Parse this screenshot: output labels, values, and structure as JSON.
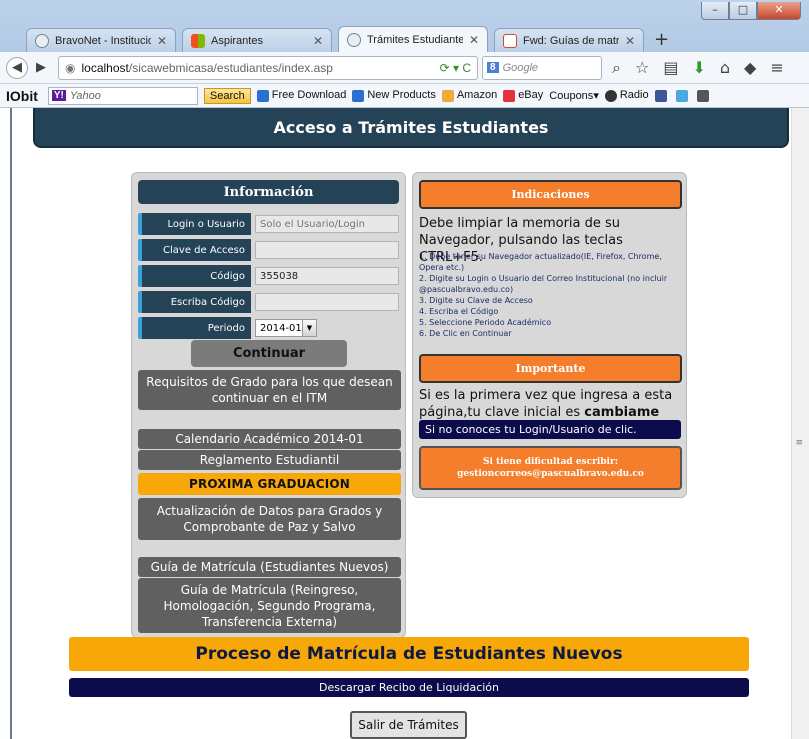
{
  "browser": {
    "tabs": [
      {
        "label": "BravoNet - Institucio...",
        "icon": "globe-icon",
        "color": "#8aa0b8"
      },
      {
        "label": "Aspirantes",
        "icon": "windows-icon",
        "color": "#e8a23c"
      },
      {
        "label": "Trámites Estudiantes...",
        "icon": "globe-icon",
        "color": "#8aa0b8"
      },
      {
        "label": "Fwd: Guías de matrí...",
        "icon": "gmail-icon",
        "color": "#d44638"
      }
    ],
    "url_host": "localhost",
    "url_path": "/sicawebmicasa/estudiantes/index.asp",
    "search_placeholder": "Google",
    "toolbar": {
      "brand": "IObit",
      "yahoo_placeholder": "Yahoo",
      "search_button": "Search",
      "items": [
        "Free Download",
        "New Products",
        "Amazon",
        "eBay",
        "Coupons",
        "Radio"
      ]
    }
  },
  "header": {
    "title": "Acceso a Trámites Estudiantes"
  },
  "info_panel": {
    "title": "Información",
    "fields": [
      {
        "label": "Login o Usuario",
        "placeholder": "Solo el Usuario/Login",
        "value": ""
      },
      {
        "label": "Clave de Acceso",
        "placeholder": "",
        "value": ""
      },
      {
        "label": "Código",
        "placeholder": "",
        "value": "355038"
      },
      {
        "label": "Escriba Código",
        "placeholder": "",
        "value": ""
      }
    ],
    "period_label": "Periodo",
    "period_value": "2014-01",
    "continue_button": "Continuar",
    "buttons": [
      "Requisitos de Grado para los que desean continuar en el ITM",
      "Calendario Académico 2014-01",
      "Reglamento Estudiantil",
      "PROXIMA GRADUACION",
      "Actualización de Datos para Grados y Comprobante de Paz y Salvo",
      "Guía de Matrícula (Estudiantes Nuevos)",
      "Guía de Matrícula (Reingreso, Homologación, Segundo Programa, Transferencia Externa)"
    ]
  },
  "indications_panel": {
    "title": "Indicaciones",
    "intro": "Debe limpiar la memoria de su Navegador, pulsando las teclas CTRL+F5.",
    "steps": [
      "1. Debe tener su Navegador actualizado(IE, Firefox, Chrome, Opera etc.)",
      "2. Digite su Login o Usuario del Correo Institucional (no incluir @pascualbravo.edu.co)",
      "3. Digite su Clave de Acceso",
      "4. Escriba el Código",
      "5. Seleccione Periodo Académico",
      "6. De Clic en Continuar"
    ],
    "important_title": "Importante",
    "important_text": "Si es la primera vez que ingresa a esta página,tu clave inicial es",
    "important_strong": "cambiame",
    "login_help_link": "Si no conoces tu Login/Usuario de clic.",
    "help_line1": "Si tiene dificultad escribir:",
    "help_line2": "gestioncorreos@pascualbravo.edu.co"
  },
  "bottom": {
    "banner": "Proceso de Matrícula de Estudiantes Nuevos",
    "receipt_link": "Descargar Recibo de Liquidación",
    "exit_button": "Salir de Trámites"
  }
}
